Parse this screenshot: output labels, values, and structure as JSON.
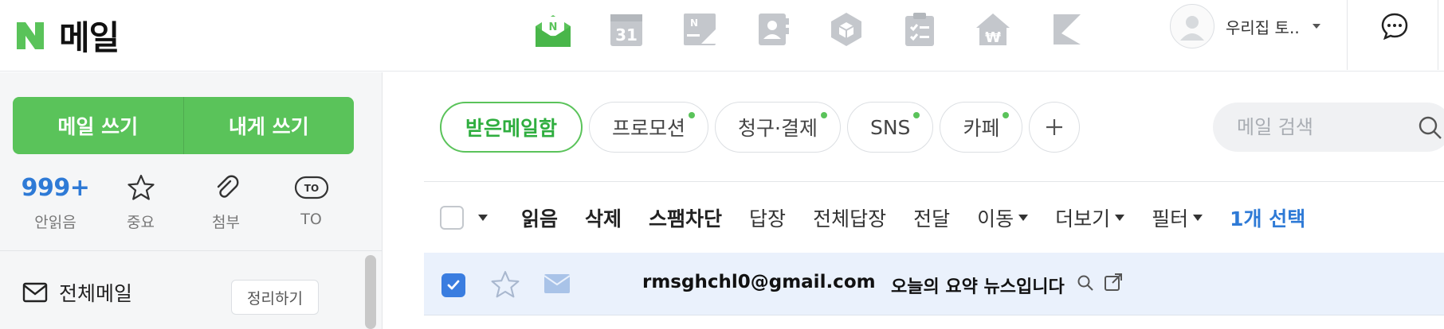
{
  "brand": {
    "logo_letter": "N",
    "title": "메일",
    "color": "#03c75a"
  },
  "apps": [
    {
      "icon": "mail-icon",
      "active": true
    },
    {
      "icon": "calendar-icon",
      "label": "31"
    },
    {
      "icon": "news-icon"
    },
    {
      "icon": "contacts-icon"
    },
    {
      "icon": "box-icon"
    },
    {
      "icon": "checklist-icon"
    },
    {
      "icon": "household-ledger-icon",
      "label": "₩"
    },
    {
      "icon": "bookmark-icon"
    }
  ],
  "profile": {
    "name": "우리집 토.."
  },
  "sidebar": {
    "compose_label": "메일 쓰기",
    "self_compose_label": "내게 쓰기",
    "quick": [
      {
        "count": "999+",
        "label": "안읽음"
      },
      {
        "icon": "star-icon",
        "label": "중요"
      },
      {
        "icon": "paperclip-icon",
        "label": "첨부"
      },
      {
        "icon": "to-icon",
        "icon_text": "TO",
        "label": "TO"
      }
    ],
    "all_mail_label": "전체메일",
    "cleanup_label": "정리하기"
  },
  "tabs": [
    {
      "label": "받은메일함",
      "active": true,
      "dot": false
    },
    {
      "label": "프로모션",
      "active": false,
      "dot": true
    },
    {
      "label": "청구·결제",
      "active": false,
      "dot": true
    },
    {
      "label": "SNS",
      "active": false,
      "dot": true
    },
    {
      "label": "카페",
      "active": false,
      "dot": true
    }
  ],
  "search": {
    "placeholder": "메일 검색"
  },
  "toolbar": {
    "read": "읽음",
    "delete": "삭제",
    "spam": "스팸차단",
    "reply": "답장",
    "reply_all": "전체답장",
    "forward": "전달",
    "move": "이동",
    "more": "더보기",
    "filter": "필터",
    "selected": "1개 선택"
  },
  "mail_rows": [
    {
      "from": "rmsghchl0@gmail.com",
      "subject": "오늘의 요약 뉴스입니다",
      "checked": true,
      "starred": false
    }
  ],
  "colors": {
    "accent_green": "#5ac35a",
    "accent_blue": "#2e7ad6",
    "selected_row": "#eaf1fc"
  }
}
